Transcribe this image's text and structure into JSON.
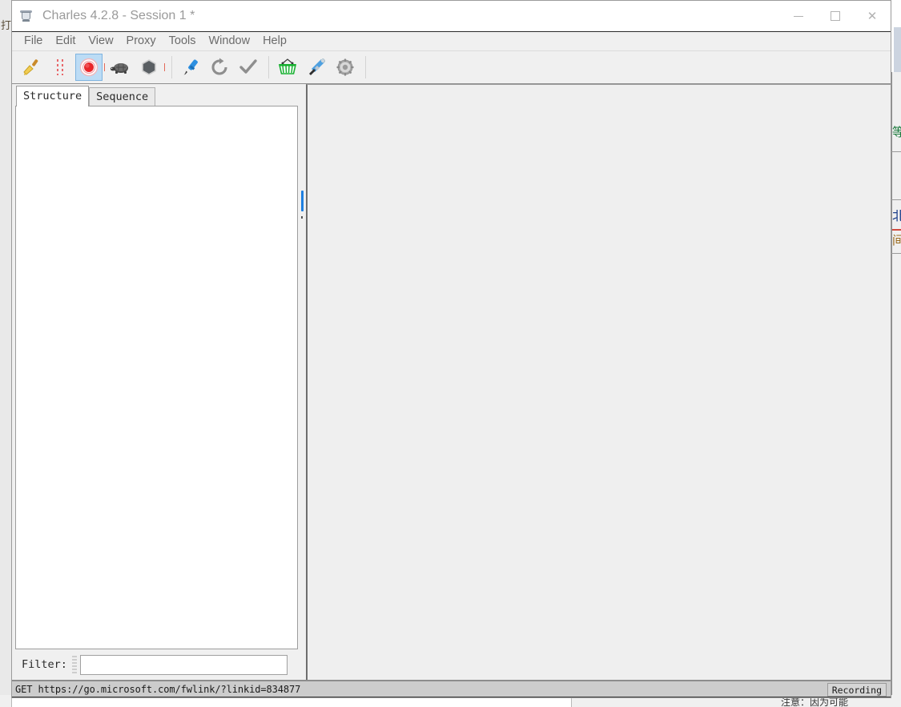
{
  "window": {
    "title": "Charles 4.2.8 - Session 1 *",
    "app_icon": "charles-bottle-icon",
    "controls": {
      "minimize": "—",
      "maximize": "□",
      "close": "✕"
    }
  },
  "menu": {
    "items": [
      {
        "label": "File"
      },
      {
        "label": "Edit"
      },
      {
        "label": "View"
      },
      {
        "label": "Proxy"
      },
      {
        "label": "Tools"
      },
      {
        "label": "Window"
      },
      {
        "label": "Help"
      }
    ]
  },
  "toolbar": {
    "buttons": [
      {
        "name": "clear-session-icon",
        "tooltip": "Clear the current session"
      },
      {
        "name": "pause-recording-icon",
        "tooltip": "Pause recording"
      },
      {
        "name": "record-icon",
        "tooltip": "Start/Stop recording",
        "selected": true
      },
      {
        "name": "throttle-icon",
        "tooltip": "Start/Stop throttling"
      },
      {
        "name": "breakpoints-icon",
        "tooltip": "Enable/Disable breakpoints"
      },
      {
        "name": "compose-icon",
        "tooltip": "Compose a new request"
      },
      {
        "name": "repeat-icon",
        "tooltip": "Repeat the request"
      },
      {
        "name": "validate-icon",
        "tooltip": "Validate"
      },
      {
        "name": "tools-basket-icon",
        "tooltip": "Tools"
      },
      {
        "name": "settings-tools-icon",
        "tooltip": "Settings"
      },
      {
        "name": "gear-icon",
        "tooltip": "Preferences"
      }
    ]
  },
  "left_panel": {
    "tabs": [
      {
        "label": "Structure",
        "active": true
      },
      {
        "label": "Sequence",
        "active": false
      }
    ],
    "tree_items": [],
    "filter": {
      "label": "Filter:",
      "value": "",
      "placeholder": ""
    }
  },
  "right_panel": {
    "content": ""
  },
  "statusbar": {
    "message": "GET https://go.microsoft.com/fwlink/?linkid=834877",
    "recording_badge": "Recording"
  },
  "background": {
    "left_glyph": "打",
    "right_glyph_1": "等",
    "right_glyph_2": "北",
    "right_glyph_3": "间",
    "bottom_text": "注意：因为可能"
  },
  "colors": {
    "accent_blue": "#1e7fe0",
    "record_red": "#e8262a",
    "selected_bg": "#bcdcf5",
    "window_bg": "#f0f0f0",
    "panel_bg": "#efefef",
    "statusbar_bg": "#cccccc"
  }
}
